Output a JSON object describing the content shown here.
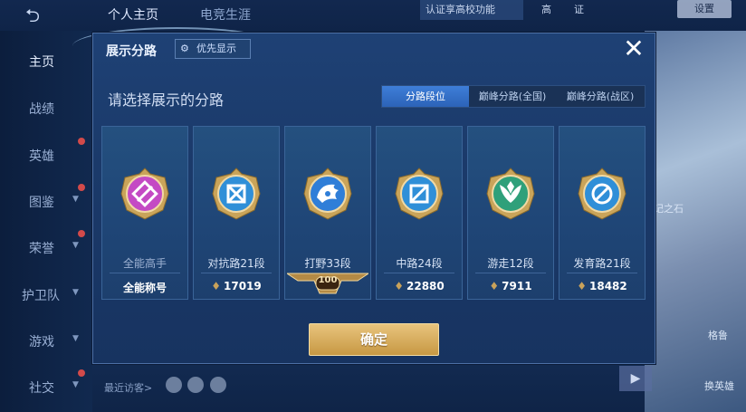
{
  "background": {
    "top_tabs": [
      "个人主页",
      "电竞生涯"
    ],
    "verify_banner": "认证享高校功能",
    "top_right_text": [
      "高",
      "证"
    ],
    "settings_label": "设置",
    "sidebar": [
      {
        "label": "主页",
        "active": true
      },
      {
        "label": "战绩"
      },
      {
        "label": "英雄"
      },
      {
        "label": "图鉴"
      },
      {
        "label": "荣誉"
      },
      {
        "label": "护卫队"
      },
      {
        "label": "游戏"
      },
      {
        "label": "社交"
      }
    ],
    "recent_visitors": "最近访客>",
    "right_labels": [
      "记之石",
      "换英雄",
      "格鲁"
    ]
  },
  "modal": {
    "title": "展示分路",
    "priority_label": "优先显示",
    "close_icon": "close-icon",
    "subtitle": "请选择展示的分路",
    "tabs": [
      "分路段位",
      "巅峰分路(全国)",
      "巅峰分路(战区)"
    ],
    "active_tab": 0,
    "cards": [
      {
        "lane": "全能高手",
        "value": "全能称号",
        "icon": "all-round-emblem-icon",
        "color": "#c44ac4"
      },
      {
        "lane": "对抗路21段",
        "value": "17019",
        "icon": "clash-lane-emblem-icon",
        "color": "#2f8fd8"
      },
      {
        "lane": "打野33段",
        "value": "100",
        "icon": "jungle-emblem-icon",
        "color": "#2f7ed8"
      },
      {
        "lane": "中路24段",
        "value": "22880",
        "icon": "mid-lane-emblem-icon",
        "color": "#2f8fd8"
      },
      {
        "lane": "游走12段",
        "value": "7911",
        "icon": "roam-emblem-icon",
        "color": "#2fa07a"
      },
      {
        "lane": "发育路21段",
        "value": "18482",
        "icon": "farm-lane-emblem-icon",
        "color": "#2f8fd8"
      }
    ],
    "points_icon": "points-icon",
    "confirm_label": "确定"
  }
}
